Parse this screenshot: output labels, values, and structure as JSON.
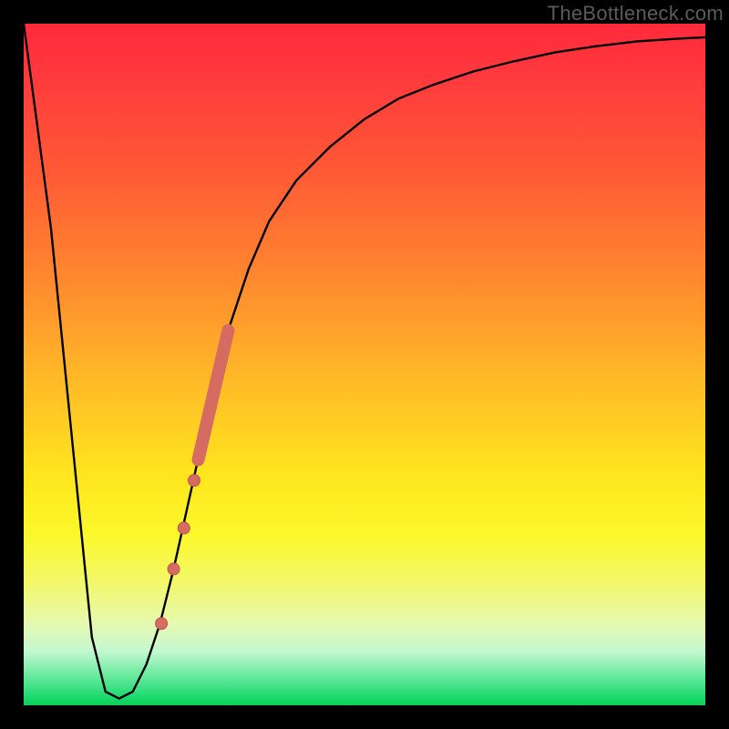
{
  "watermark": {
    "text": "TheBottleneck.com"
  },
  "palette": {
    "curve_stroke": "#000000",
    "marker_fill": "#d66b61",
    "marker_stroke": "#b9564d",
    "thick_segment_stroke": "#d66b61"
  },
  "chart_data": {
    "type": "line",
    "title": "",
    "xlabel": "",
    "ylabel": "",
    "xlim": [
      0,
      100
    ],
    "ylim": [
      0,
      100
    ],
    "grid": false,
    "legend": false,
    "series": [
      {
        "name": "bottleneck-curve",
        "x": [
          0,
          4,
          8,
          10,
          12,
          14,
          16,
          18,
          20,
          22,
          24,
          26,
          28,
          30,
          33,
          36,
          40,
          45,
          50,
          55,
          60,
          66,
          72,
          78,
          84,
          90,
          96,
          100
        ],
        "values": [
          100,
          70,
          30,
          10,
          2,
          1,
          2,
          6,
          12,
          20,
          29,
          38,
          47,
          55,
          64,
          71,
          77,
          82,
          86,
          89,
          91,
          93,
          94.5,
          95.8,
          96.7,
          97.4,
          97.8,
          98
        ]
      }
    ],
    "markers": {
      "points": [
        {
          "x": 20.2,
          "y": 12
        },
        {
          "x": 22.0,
          "y": 20
        },
        {
          "x": 23.5,
          "y": 26
        },
        {
          "x": 25.0,
          "y": 33
        }
      ],
      "thick_segment": {
        "x0": 25.6,
        "y0": 36,
        "x1": 30.0,
        "y1": 55
      }
    }
  }
}
